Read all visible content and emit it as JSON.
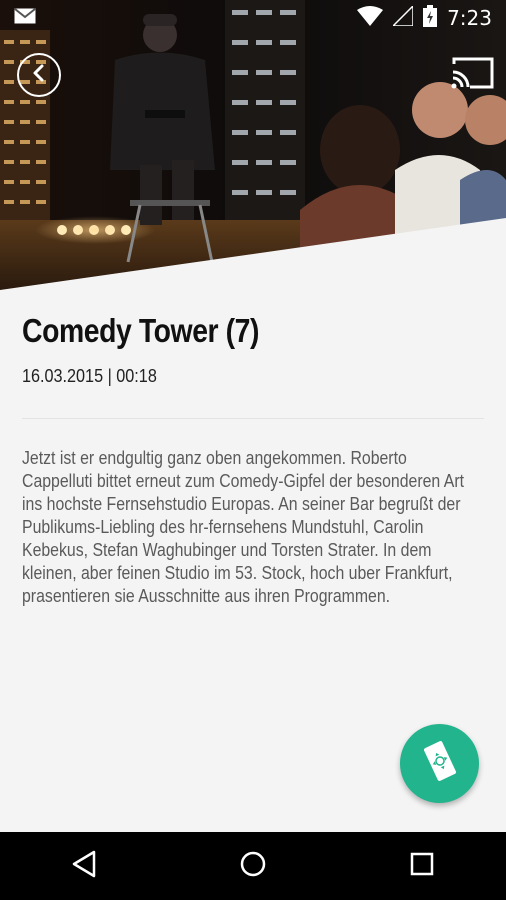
{
  "status_bar": {
    "time": "7:23",
    "icons": [
      "gmail-icon",
      "wifi-icon",
      "signal-icon",
      "battery-icon"
    ]
  },
  "header": {
    "back_icon": "back-arrow-icon",
    "cast_icon": "cast-icon"
  },
  "episode": {
    "title": "Comedy Tower (7)",
    "date_duration": "16.03.2015 | 00:18",
    "description": "Jetzt ist er endgultig ganz oben angekommen. Roberto Cappelluti bittet erneut zum Comedy-Gipfel der besonderen Art ins hochste Fernsehstudio Europas. An seiner Bar begrußt der Publikums-Liebling des hr-fernsehens Mundstuhl, Carolin Kebekus, Stefan Waghubinger und Torsten Strater. In dem kleinen, aber feinen Studio im 53. Stock, hoch uber Frankfurt, prasentieren sie Ausschnitte aus ihren Programmen."
  },
  "fab": {
    "icon": "remote-control-icon",
    "color": "#22b48d"
  },
  "nav_bar": {
    "icons": [
      "back-triangle-icon",
      "home-circle-icon",
      "recents-square-icon"
    ]
  }
}
